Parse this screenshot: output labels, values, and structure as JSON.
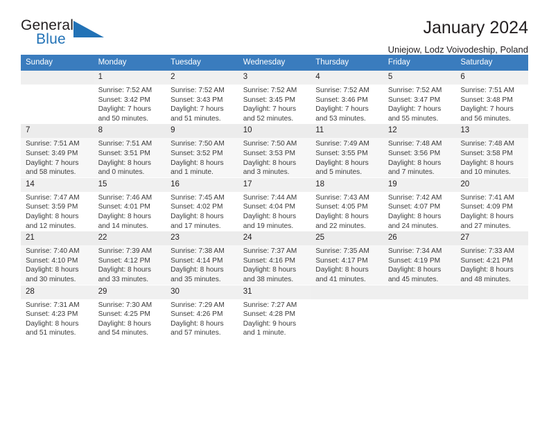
{
  "logo": {
    "word1": "General",
    "word2": "Blue",
    "triangle_color": "#2272b6",
    "icon": "triangle-flag-icon"
  },
  "header": {
    "title": "January 2024",
    "subtitle": "Uniejow, Lodz Voivodeship, Poland"
  },
  "colors": {
    "header_row_bg": "#3a7cbe",
    "header_row_text": "#ffffff",
    "daynum_bg": "#efefef",
    "row_alt_bg": "#f7f7f7",
    "text": "#231f20",
    "brand_blue": "#2272b6"
  },
  "weekday_headers": [
    "Sunday",
    "Monday",
    "Tuesday",
    "Wednesday",
    "Thursday",
    "Friday",
    "Saturday"
  ],
  "weeks": [
    [
      {
        "day": "",
        "info": ""
      },
      {
        "day": "1",
        "info": "Sunrise: 7:52 AM\nSunset: 3:42 PM\nDaylight: 7 hours\nand 50 minutes."
      },
      {
        "day": "2",
        "info": "Sunrise: 7:52 AM\nSunset: 3:43 PM\nDaylight: 7 hours\nand 51 minutes."
      },
      {
        "day": "3",
        "info": "Sunrise: 7:52 AM\nSunset: 3:45 PM\nDaylight: 7 hours\nand 52 minutes."
      },
      {
        "day": "4",
        "info": "Sunrise: 7:52 AM\nSunset: 3:46 PM\nDaylight: 7 hours\nand 53 minutes."
      },
      {
        "day": "5",
        "info": "Sunrise: 7:52 AM\nSunset: 3:47 PM\nDaylight: 7 hours\nand 55 minutes."
      },
      {
        "day": "6",
        "info": "Sunrise: 7:51 AM\nSunset: 3:48 PM\nDaylight: 7 hours\nand 56 minutes."
      }
    ],
    [
      {
        "day": "7",
        "info": "Sunrise: 7:51 AM\nSunset: 3:49 PM\nDaylight: 7 hours\nand 58 minutes."
      },
      {
        "day": "8",
        "info": "Sunrise: 7:51 AM\nSunset: 3:51 PM\nDaylight: 8 hours\nand 0 minutes."
      },
      {
        "day": "9",
        "info": "Sunrise: 7:50 AM\nSunset: 3:52 PM\nDaylight: 8 hours\nand 1 minute."
      },
      {
        "day": "10",
        "info": "Sunrise: 7:50 AM\nSunset: 3:53 PM\nDaylight: 8 hours\nand 3 minutes."
      },
      {
        "day": "11",
        "info": "Sunrise: 7:49 AM\nSunset: 3:55 PM\nDaylight: 8 hours\nand 5 minutes."
      },
      {
        "day": "12",
        "info": "Sunrise: 7:48 AM\nSunset: 3:56 PM\nDaylight: 8 hours\nand 7 minutes."
      },
      {
        "day": "13",
        "info": "Sunrise: 7:48 AM\nSunset: 3:58 PM\nDaylight: 8 hours\nand 10 minutes."
      }
    ],
    [
      {
        "day": "14",
        "info": "Sunrise: 7:47 AM\nSunset: 3:59 PM\nDaylight: 8 hours\nand 12 minutes."
      },
      {
        "day": "15",
        "info": "Sunrise: 7:46 AM\nSunset: 4:01 PM\nDaylight: 8 hours\nand 14 minutes."
      },
      {
        "day": "16",
        "info": "Sunrise: 7:45 AM\nSunset: 4:02 PM\nDaylight: 8 hours\nand 17 minutes."
      },
      {
        "day": "17",
        "info": "Sunrise: 7:44 AM\nSunset: 4:04 PM\nDaylight: 8 hours\nand 19 minutes."
      },
      {
        "day": "18",
        "info": "Sunrise: 7:43 AM\nSunset: 4:05 PM\nDaylight: 8 hours\nand 22 minutes."
      },
      {
        "day": "19",
        "info": "Sunrise: 7:42 AM\nSunset: 4:07 PM\nDaylight: 8 hours\nand 24 minutes."
      },
      {
        "day": "20",
        "info": "Sunrise: 7:41 AM\nSunset: 4:09 PM\nDaylight: 8 hours\nand 27 minutes."
      }
    ],
    [
      {
        "day": "21",
        "info": "Sunrise: 7:40 AM\nSunset: 4:10 PM\nDaylight: 8 hours\nand 30 minutes."
      },
      {
        "day": "22",
        "info": "Sunrise: 7:39 AM\nSunset: 4:12 PM\nDaylight: 8 hours\nand 33 minutes."
      },
      {
        "day": "23",
        "info": "Sunrise: 7:38 AM\nSunset: 4:14 PM\nDaylight: 8 hours\nand 35 minutes."
      },
      {
        "day": "24",
        "info": "Sunrise: 7:37 AM\nSunset: 4:16 PM\nDaylight: 8 hours\nand 38 minutes."
      },
      {
        "day": "25",
        "info": "Sunrise: 7:35 AM\nSunset: 4:17 PM\nDaylight: 8 hours\nand 41 minutes."
      },
      {
        "day": "26",
        "info": "Sunrise: 7:34 AM\nSunset: 4:19 PM\nDaylight: 8 hours\nand 45 minutes."
      },
      {
        "day": "27",
        "info": "Sunrise: 7:33 AM\nSunset: 4:21 PM\nDaylight: 8 hours\nand 48 minutes."
      }
    ],
    [
      {
        "day": "28",
        "info": "Sunrise: 7:31 AM\nSunset: 4:23 PM\nDaylight: 8 hours\nand 51 minutes."
      },
      {
        "day": "29",
        "info": "Sunrise: 7:30 AM\nSunset: 4:25 PM\nDaylight: 8 hours\nand 54 minutes."
      },
      {
        "day": "30",
        "info": "Sunrise: 7:29 AM\nSunset: 4:26 PM\nDaylight: 8 hours\nand 57 minutes."
      },
      {
        "day": "31",
        "info": "Sunrise: 7:27 AM\nSunset: 4:28 PM\nDaylight: 9 hours\nand 1 minute."
      },
      {
        "day": "",
        "info": ""
      },
      {
        "day": "",
        "info": ""
      },
      {
        "day": "",
        "info": ""
      }
    ]
  ]
}
